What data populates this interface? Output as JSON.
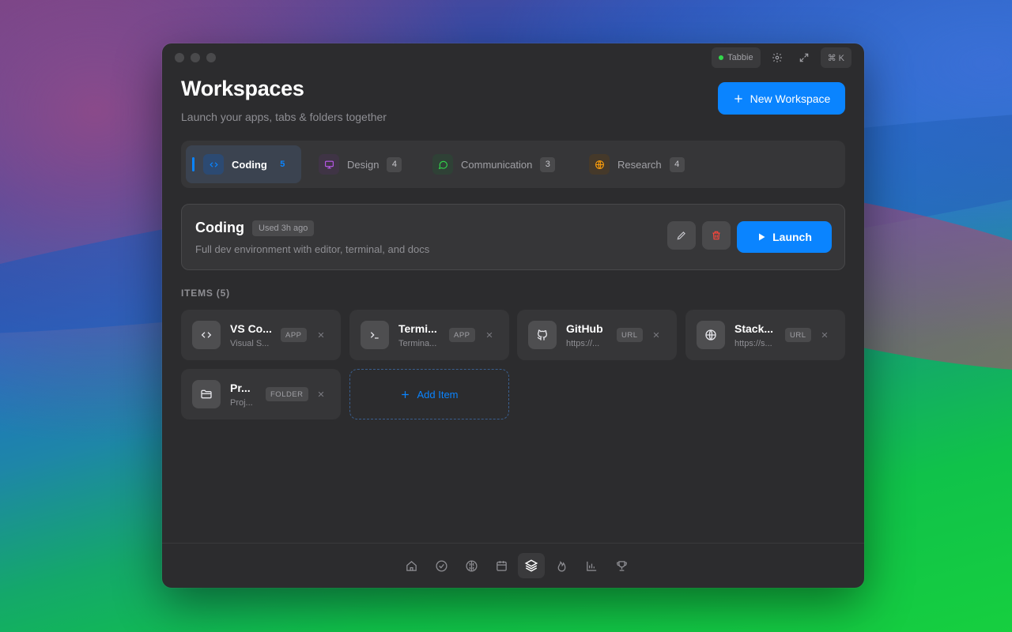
{
  "titlebar": {
    "status_label": "Tabbie",
    "shortcut": "⌘ K"
  },
  "header": {
    "title": "Workspaces",
    "subtitle": "Launch your apps, tabs & folders together",
    "new_button": "New Workspace"
  },
  "tabs": [
    {
      "label": "Coding",
      "count": "5",
      "icon": "code-icon",
      "color": "#0a84ff",
      "active": true
    },
    {
      "label": "Design",
      "count": "4",
      "icon": "monitor-icon",
      "color": "#bf5af2"
    },
    {
      "label": "Communication",
      "count": "3",
      "icon": "chat-icon",
      "color": "#32d74b"
    },
    {
      "label": "Research",
      "count": "4",
      "icon": "globe-icon",
      "color": "#ff9f0a"
    }
  ],
  "workspace": {
    "name": "Coding",
    "used": "Used 3h ago",
    "description": "Full dev environment with editor, terminal, and docs",
    "launch_label": "Launch"
  },
  "items_label": "ITEMS (5)",
  "items": [
    {
      "name": "VS Co...",
      "sub": "Visual S...",
      "type": "APP",
      "icon": "code-icon"
    },
    {
      "name": "Termi...",
      "sub": "Termina...",
      "type": "APP",
      "icon": "terminal-icon"
    },
    {
      "name": "GitHub",
      "sub": "https://...",
      "type": "URL",
      "icon": "github-icon"
    },
    {
      "name": "Stack...",
      "sub": "https://s...",
      "type": "URL",
      "icon": "globe-icon"
    },
    {
      "name": "Pr...",
      "sub": "Proj...",
      "type": "FOLDER",
      "icon": "folder-icon"
    }
  ],
  "add_item_label": "Add Item",
  "nav": [
    "home-icon",
    "check-circle-icon",
    "brain-icon",
    "calendar-icon",
    "layers-icon",
    "flame-icon",
    "bar-chart-icon",
    "trophy-icon"
  ],
  "accent": "#0a84ff"
}
